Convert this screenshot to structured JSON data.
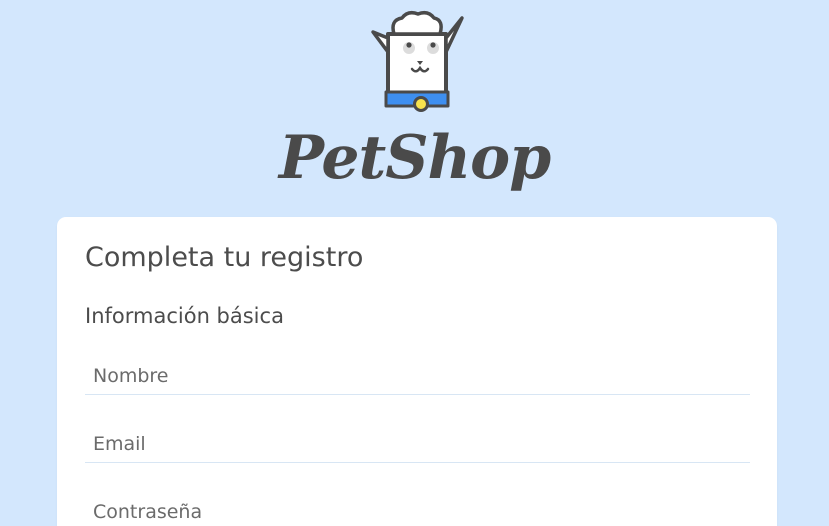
{
  "brand": {
    "name": "PetShop",
    "logo_icon": "dog-with-chef-hat-icon",
    "colors": {
      "text": "#4a4a4a",
      "collar": "#3e8ff0",
      "tag": "#f7e24d"
    }
  },
  "form": {
    "title": "Completa tu registro",
    "section_title": "Información básica",
    "fields": {
      "nombre": {
        "placeholder": "Nombre",
        "value": ""
      },
      "email": {
        "placeholder": "Email",
        "value": ""
      },
      "password": {
        "placeholder": "Contraseña",
        "value": ""
      }
    }
  },
  "theme": {
    "background": "#d3e7fd",
    "card": "#ffffff",
    "field_underline": "#d8e6f4"
  }
}
